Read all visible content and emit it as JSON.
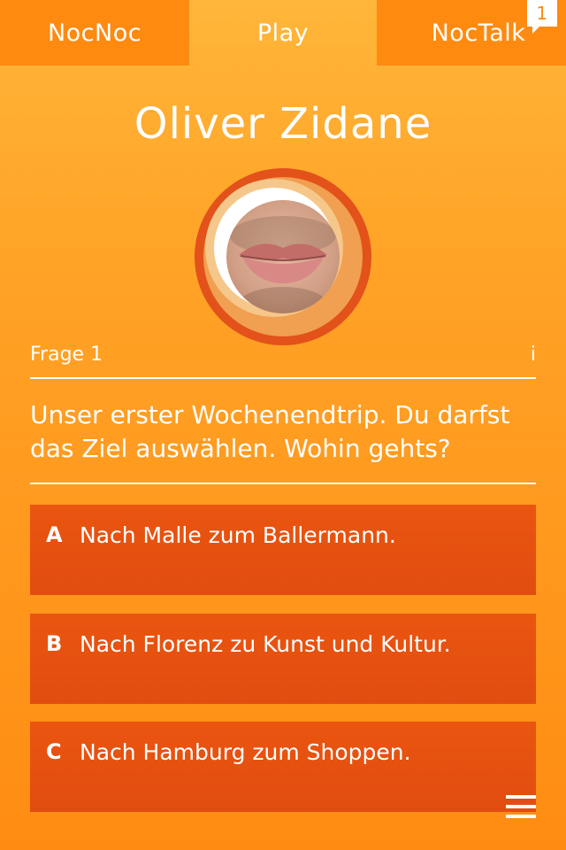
{
  "tabs": {
    "left": "NocNoc",
    "center": "Play",
    "right": "NocTalk",
    "right_badge": "1"
  },
  "profile": {
    "name": "Oliver Zidane"
  },
  "question": {
    "label": "Frage 1",
    "info": "i",
    "text": "Unser erster Wochenendtrip. Du darfst das Ziel auswählen. Wohin gehts?"
  },
  "answers": [
    {
      "letter": "A",
      "text": "Nach Malle zum Ballermann."
    },
    {
      "letter": "B",
      "text": "Nach Florenz zu Kunst und Kultur."
    },
    {
      "letter": "C",
      "text": "Nach Hamburg zum Shoppen."
    }
  ],
  "icons": {
    "menu": "hamburger-menu-icon",
    "avatar": "avatar-photo"
  },
  "colors": {
    "background_top": "#ffb63a",
    "background_bottom": "#ff8c12",
    "tab_inactive": "#ff8a10",
    "answer_bg": "#e14d10",
    "avatar_ring": "#e2521a"
  }
}
